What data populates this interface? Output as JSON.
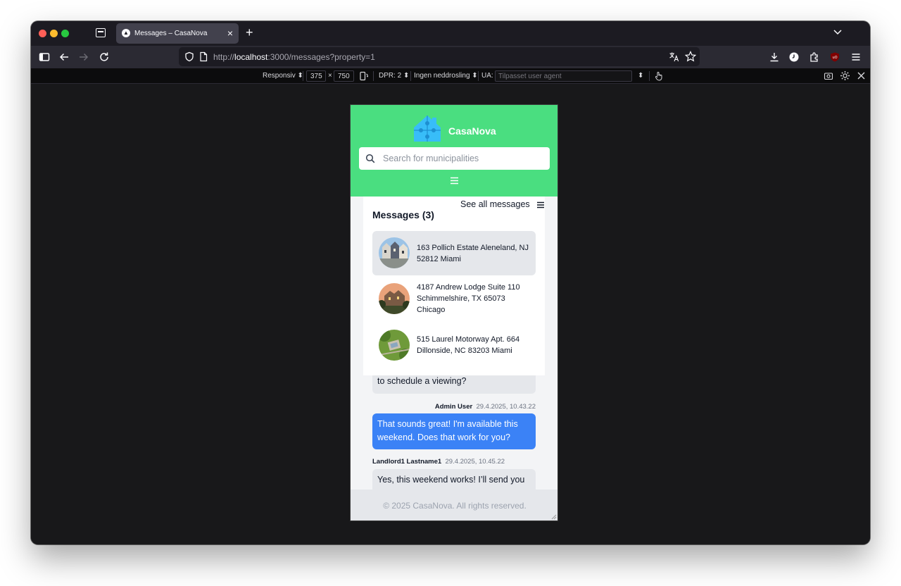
{
  "browser": {
    "tab_title": "Messages – CasaNova",
    "url_prefix": "http://",
    "url_host": "localhost",
    "url_rest": ":3000/messages?property=1"
  },
  "rdm": {
    "device": "Responsiv",
    "width": "375",
    "times": "×",
    "height": "750",
    "dpr": "DPR: 2",
    "throttle": "Ingen neddrosling",
    "ua_label": "UA:",
    "ua_placeholder": "Tilpasset user agent"
  },
  "app": {
    "brand": "CasaNova",
    "search_placeholder": "Search for municipalities",
    "see_all": "See all messages",
    "messages_title": "Messages (3)",
    "properties": [
      {
        "address": "163 Pollich Estate Aleneland, NJ 52812 Miami",
        "selected": true
      },
      {
        "address": "4187 Andrew Lodge Suite 110 Schimmelshire, TX 65073 Chicago",
        "selected": false
      },
      {
        "address": "515 Laurel Motorway Apt. 664 Dillonside, NC 83203 Miami",
        "selected": false
      }
    ],
    "chat": [
      {
        "text": "to schedule a viewing?"
      },
      {
        "sender": "Admin User",
        "time": "29.4.2025, 10.43.22",
        "text": "That sounds great! I'm available this weekend. Does that work for you?"
      },
      {
        "sender": "Landlord1 Lastname1",
        "time": "29.4.2025, 10.45.22",
        "text": "Yes, this weekend works! I’ll send you"
      }
    ],
    "footer": "© 2025 CasaNova. All rights reserved."
  },
  "colors": {
    "header": "#4ade80",
    "accent_blue": "#3b82f6",
    "bubble_grey": "#e5e7eb"
  }
}
